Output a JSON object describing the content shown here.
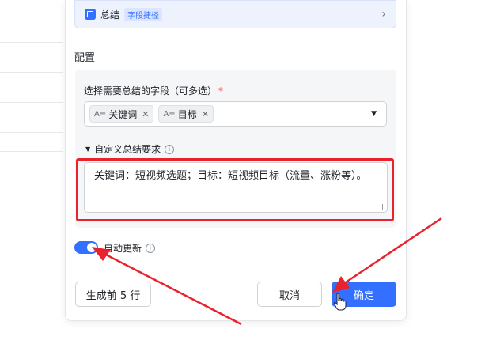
{
  "summary": {
    "title": "总结",
    "tag": "字段捷径",
    "chevron": "›"
  },
  "config": {
    "section_label": "配置",
    "field_label": "选择需要总结的字段（可多选）",
    "required_mark": "*",
    "chips": [
      {
        "icon": "A≡",
        "label": "关键词",
        "remove": "✕"
      },
      {
        "icon": "A≡",
        "label": "目标",
        "remove": "✕"
      }
    ],
    "select_arrow": "▼",
    "custom_label": "自定义总结要求",
    "custom_toggle": "▼",
    "info": "i",
    "custom_text": "关键词：短视频选题；目标：短视频目标（流量、涨粉等）。"
  },
  "auto_update": {
    "label": "自动更新",
    "enabled": true,
    "info": "i"
  },
  "buttons": {
    "generate": "生成前 5 行",
    "cancel": "取消",
    "confirm": "确定"
  },
  "colors": {
    "accent": "#3370ff",
    "annotation_red": "#e8232d"
  }
}
